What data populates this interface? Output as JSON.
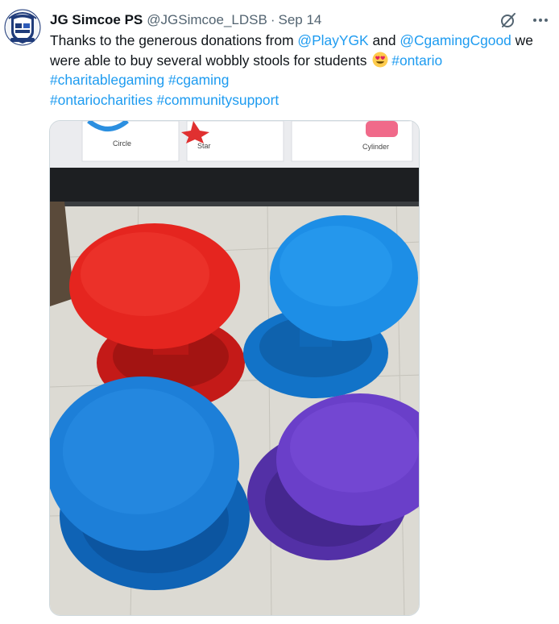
{
  "tweet": {
    "author_name": "JG Simcoe PS",
    "handle": "@JGSimcoe_LDSB",
    "separator": "·",
    "date": "Sep 14",
    "text": {
      "p1": "Thanks to the generous donations from ",
      "m1": "@PlayYGK",
      "p2": " and ",
      "m2": "@CgamingCgood",
      "p3": " we were able to buy several wobbly stools for students",
      "h1": "#ontario",
      "h2": "#charitablegaming",
      "h3": "#cgaming",
      "h4": "#ontariocharities",
      "h5": "#communitysupport"
    },
    "media": {
      "posters": [
        "Circle",
        "Star",
        "Cylinder"
      ]
    }
  },
  "icons": {
    "avatar": "school-crest-logo",
    "top_right": [
      "grok-icon",
      "more-icon"
    ],
    "emoji": "heart-eyes-emoji"
  },
  "colors": {
    "link": "#1d9bf0",
    "text": "#0f1419",
    "secondary": "#536471"
  }
}
